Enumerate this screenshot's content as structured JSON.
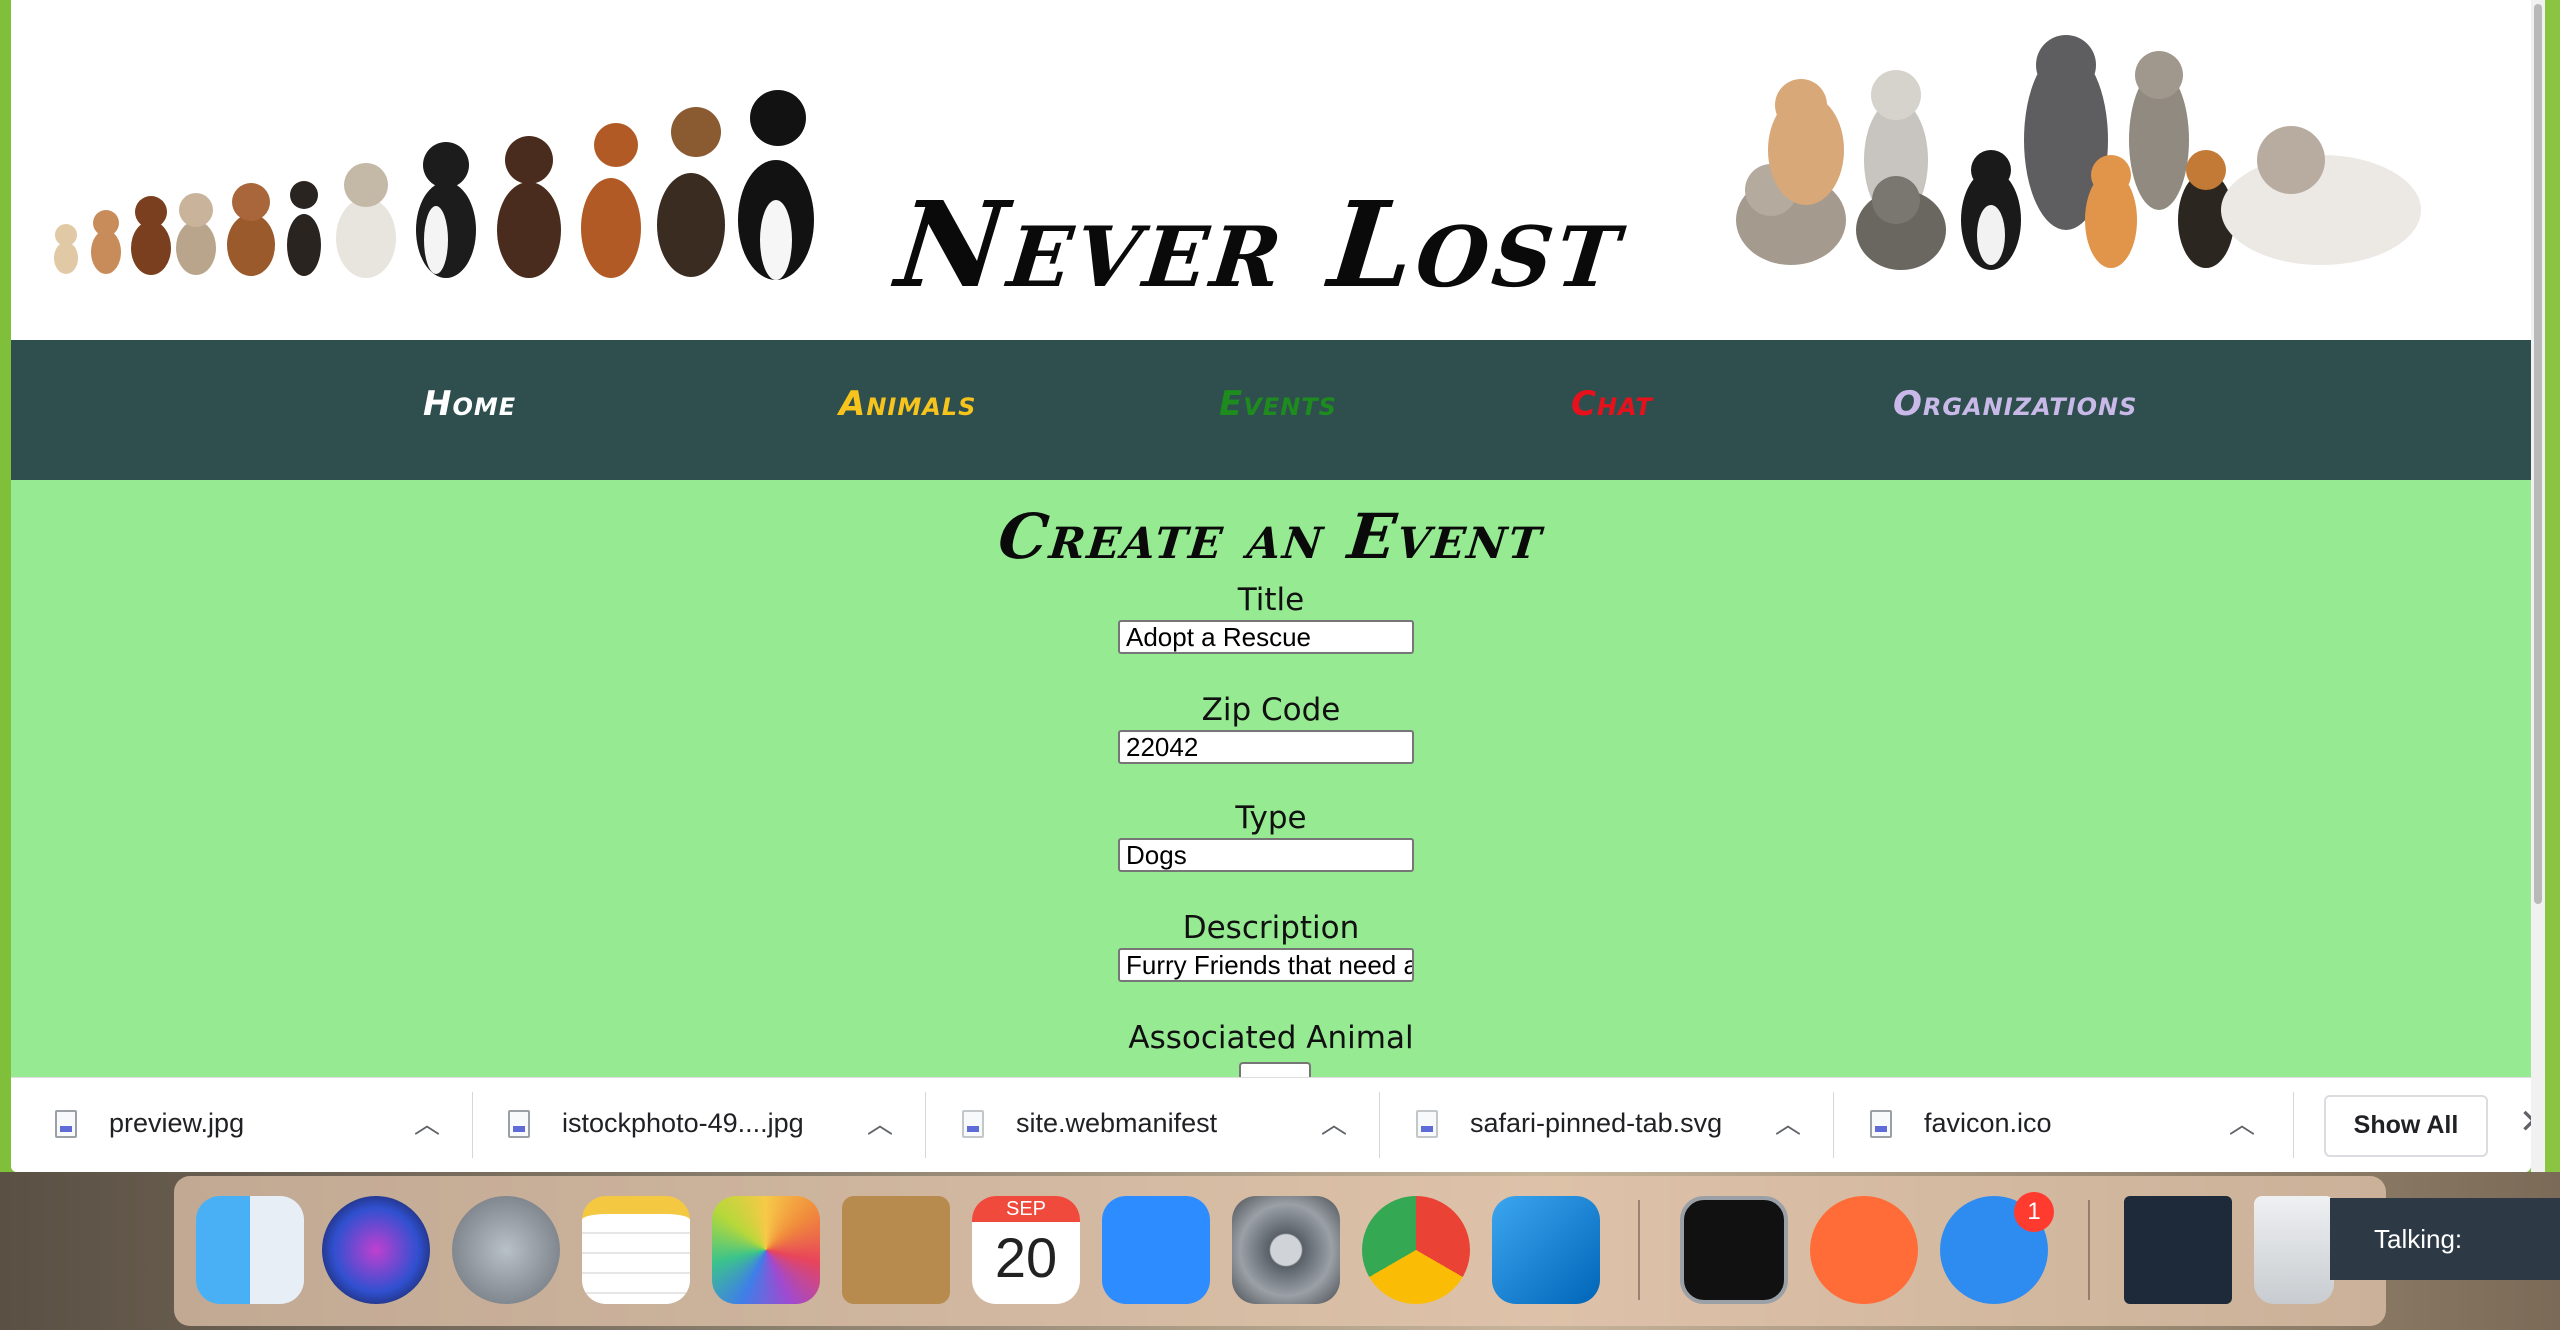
{
  "site": {
    "title": "Never Lost"
  },
  "nav": [
    {
      "label": "Home",
      "color": "#ffffff"
    },
    {
      "label": "Animals",
      "color": "#f6c41c"
    },
    {
      "label": "Events",
      "color": "#1e8b1e"
    },
    {
      "label": "Chat",
      "color": "#e8111b"
    },
    {
      "label": "Organizations",
      "color": "#c9b9e8"
    }
  ],
  "form": {
    "heading": "Create an Event",
    "fields": [
      {
        "label": "Title",
        "value": "Adopt a Rescue"
      },
      {
        "label": "Zip Code",
        "value": "22042"
      },
      {
        "label": "Type",
        "value": "Dogs"
      },
      {
        "label": "Description",
        "value": "Furry Friends that need a"
      },
      {
        "label": "Associated Animal",
        "value": ""
      }
    ]
  },
  "downloads": {
    "items": [
      {
        "name": "preview.jpg",
        "icon": "jpeg-file-icon"
      },
      {
        "name": "istockphoto-49....jpg",
        "icon": "jpeg-file-icon"
      },
      {
        "name": "site.webmanifest",
        "icon": "blank-file-icon"
      },
      {
        "name": "safari-pinned-tab.svg",
        "icon": "document-file-icon"
      },
      {
        "name": "favicon.ico",
        "icon": "ico-file-icon"
      }
    ],
    "show_all": "Show All",
    "close": "✕"
  },
  "dock": {
    "apps": [
      "finder-icon",
      "siri-icon",
      "launchpad-icon",
      "notes-icon",
      "photos-icon",
      "contacts-icon",
      "calendar-icon",
      "zoom-icon",
      "system-preferences-icon",
      "chrome-icon",
      "vscode-icon",
      "activity-monitor-icon",
      "postman-icon",
      "messages-icon",
      "vscode-window-icon",
      "trash-icon"
    ],
    "calendar_month": "SEP",
    "calendar_day": "20",
    "messages_badge": "1"
  },
  "overlay": {
    "talking": "Talking:"
  },
  "colors": {
    "header_bg": "#ffffff",
    "nav_bg": "#2f4f4f",
    "main_bg": "#95ea92"
  }
}
